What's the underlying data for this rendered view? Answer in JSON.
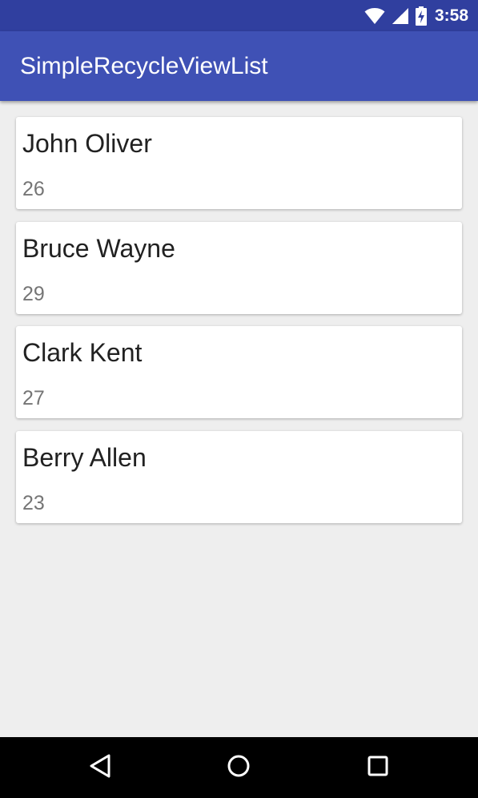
{
  "status_bar": {
    "time": "3:58",
    "icons": [
      "wifi-icon",
      "cellular-signal-icon",
      "battery-charging-icon"
    ]
  },
  "app_bar": {
    "title": "SimpleRecycleViewList",
    "color": "#3f51b5",
    "status_color": "#303f9f"
  },
  "list": {
    "items": [
      {
        "name": "John Oliver",
        "age": "26"
      },
      {
        "name": "Bruce Wayne",
        "age": "29"
      },
      {
        "name": "Clark Kent",
        "age": "27"
      },
      {
        "name": "Berry Allen",
        "age": "23"
      }
    ]
  },
  "nav_bar": {
    "buttons": [
      "back-icon",
      "home-icon",
      "recents-icon"
    ]
  }
}
